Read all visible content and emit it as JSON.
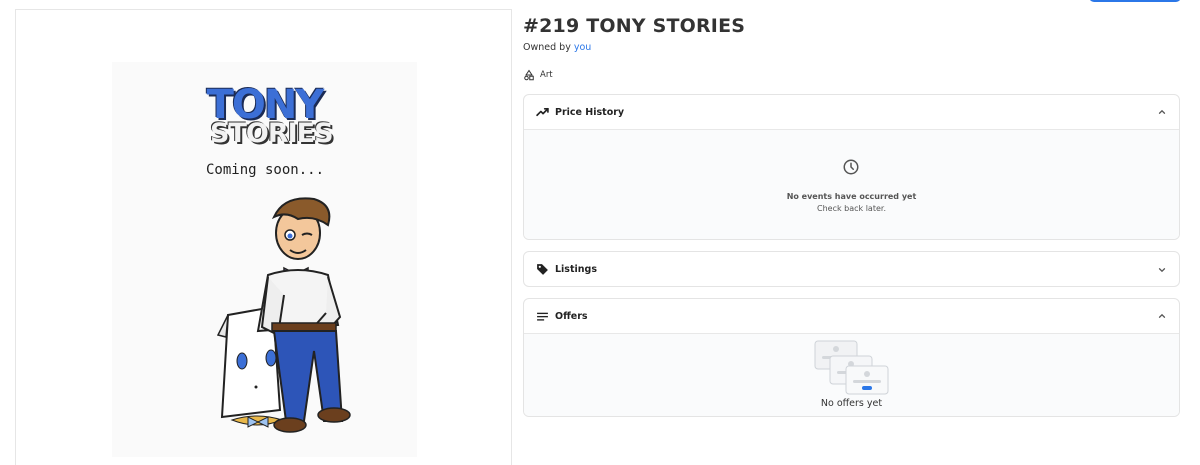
{
  "title": "#219 TONY STORIES",
  "owner": {
    "prefix": "Owned by",
    "name": "you"
  },
  "category": {
    "label": "Art",
    "icon": "shapes-icon"
  },
  "artwork": {
    "logo_line1": "TONY",
    "logo_line2": "STORIES",
    "caption": "Coming soon..."
  },
  "panels": {
    "price_history": {
      "title": "Price History",
      "icon": "trending-up-icon",
      "expanded": true,
      "empty_title": "No events have occurred yet",
      "empty_subtitle": "Check back later."
    },
    "listings": {
      "title": "Listings",
      "icon": "tag-icon",
      "expanded": false
    },
    "offers": {
      "title": "Offers",
      "icon": "list-icon",
      "expanded": true,
      "empty_text": "No offers yet"
    }
  },
  "colors": {
    "accent": "#2b77e8",
    "border": "#e4e4e4",
    "panel_bg": "#fafbfc"
  }
}
